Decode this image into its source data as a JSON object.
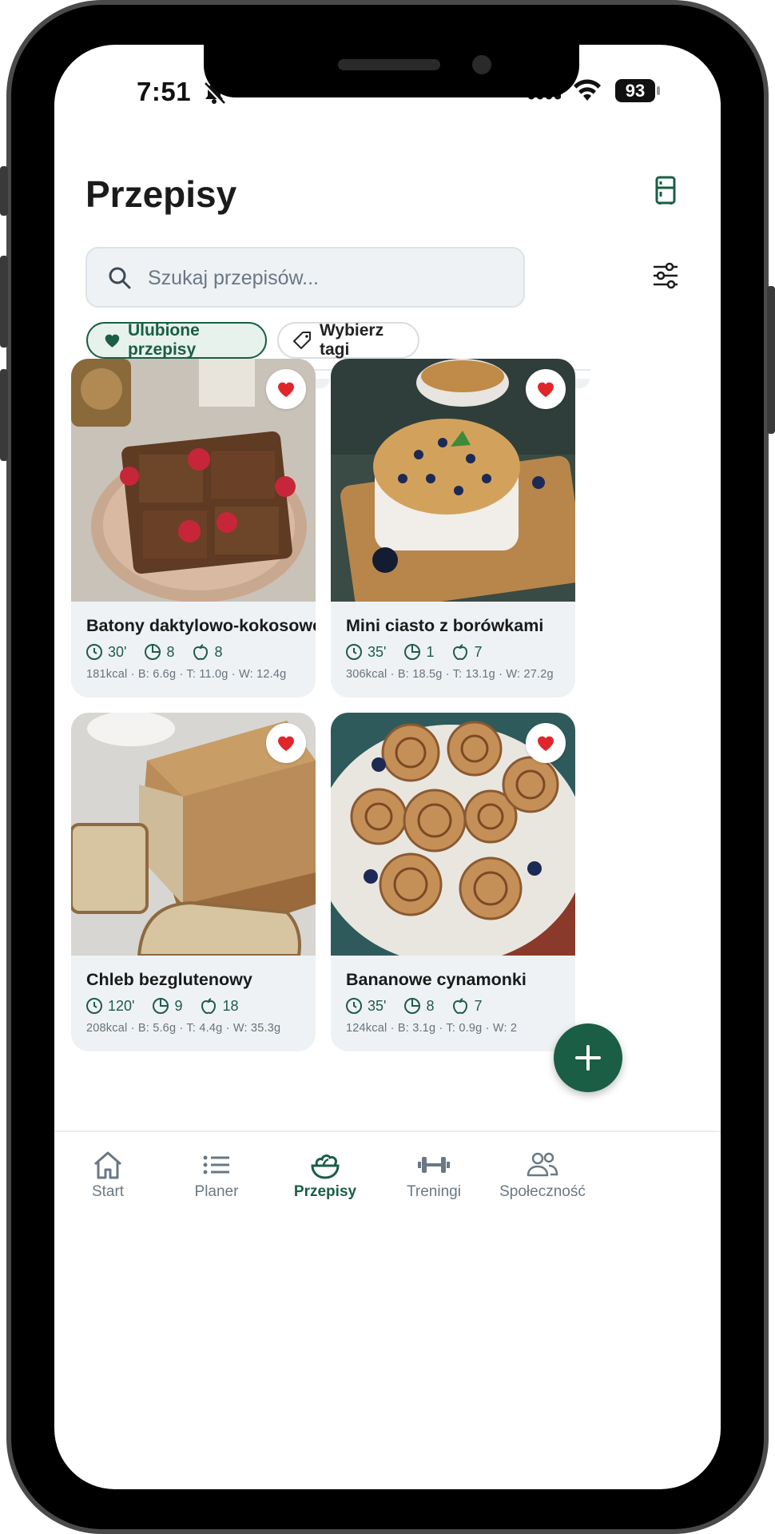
{
  "status_bar": {
    "time": "7:51",
    "battery": "93"
  },
  "header": {
    "title": "Przepisy"
  },
  "search": {
    "placeholder": "Szukaj przepisów..."
  },
  "chips": {
    "favorites": "Ulubione przepisy",
    "tags": "Wybierz tagi"
  },
  "recipes": [
    {
      "name": "Batony daktylowo-kokosowe",
      "time": "30'",
      "portions": "8",
      "ingredients": "8",
      "nutrition": "181kcal · B: 6.6g · T: 11.0g · W: 12.4g",
      "favorite": true
    },
    {
      "name": "Mini ciasto z borówkami",
      "time": "35'",
      "portions": "1",
      "ingredients": "7",
      "nutrition": "306kcal · B: 18.5g · T: 13.1g · W: 27.2g",
      "favorite": true
    },
    {
      "name": "Chleb bezglutenowy",
      "time": "120'",
      "portions": "9",
      "ingredients": "18",
      "nutrition": "208kcal · B: 5.6g · T: 4.4g · W: 35.3g",
      "favorite": true
    },
    {
      "name": "Bananowe cynamonki",
      "time": "35'",
      "portions": "8",
      "ingredients": "7",
      "nutrition": "124kcal · B: 3.1g · T: 0.9g · W: 2",
      "favorite": true
    }
  ],
  "tabs": [
    {
      "label": "Start",
      "icon": "home-icon"
    },
    {
      "label": "Planer",
      "icon": "list-icon"
    },
    {
      "label": "Przepisy",
      "icon": "salad-bowl-icon",
      "active": true
    },
    {
      "label": "Treningi",
      "icon": "dumbbell-icon"
    },
    {
      "label": "Społeczność",
      "icon": "people-icon"
    }
  ],
  "colors": {
    "accent": "#1a5e45",
    "heart": "#e0262b",
    "card_bg": "#eef2f5",
    "inactive_tab": "#6a7884"
  }
}
